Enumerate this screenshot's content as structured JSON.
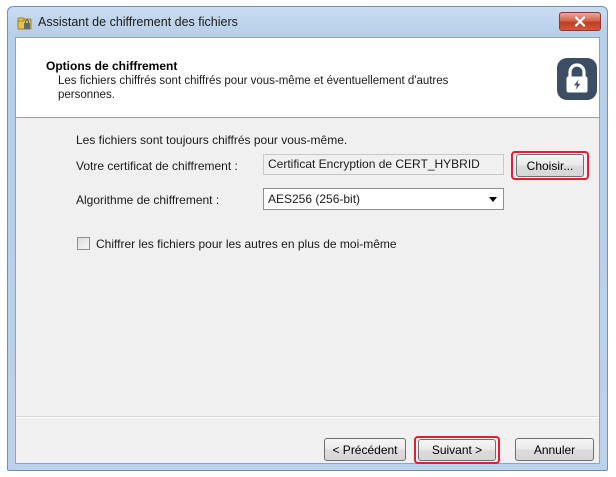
{
  "window": {
    "title": "Assistant de chiffrement des fichiers",
    "close_label": ""
  },
  "header": {
    "title": "Options de chiffrement",
    "description": "Les fichiers chiffrés sont chiffrés pour vous-même et éventuellement d'autres personnes."
  },
  "body": {
    "intro": "Les fichiers sont toujours chiffrés pour vous-même.",
    "certificate_label": "Votre certificat de chiffrement :",
    "certificate_value": "Certificat Encryption de CERT_HYBRID",
    "choose_label": "Choisir...",
    "algorithm_label": "Algorithme de chiffrement :",
    "algorithm_value": "AES256 (256-bit)",
    "others_checkbox_label": "Chiffrer les fichiers pour les autres en plus de moi-même",
    "others_checked": false
  },
  "footer": {
    "back_label": "< Précédent",
    "next_label": "Suivant >",
    "cancel_label": "Annuler"
  },
  "colors": {
    "highlight": "#e0202c",
    "close_button": "#c23d23",
    "lock_badge": "#3d4d63"
  },
  "icons": {
    "title": "folder-lock-icon",
    "header": "lock-icon",
    "close": "close-icon",
    "dropdown": "chevron-down-icon"
  }
}
